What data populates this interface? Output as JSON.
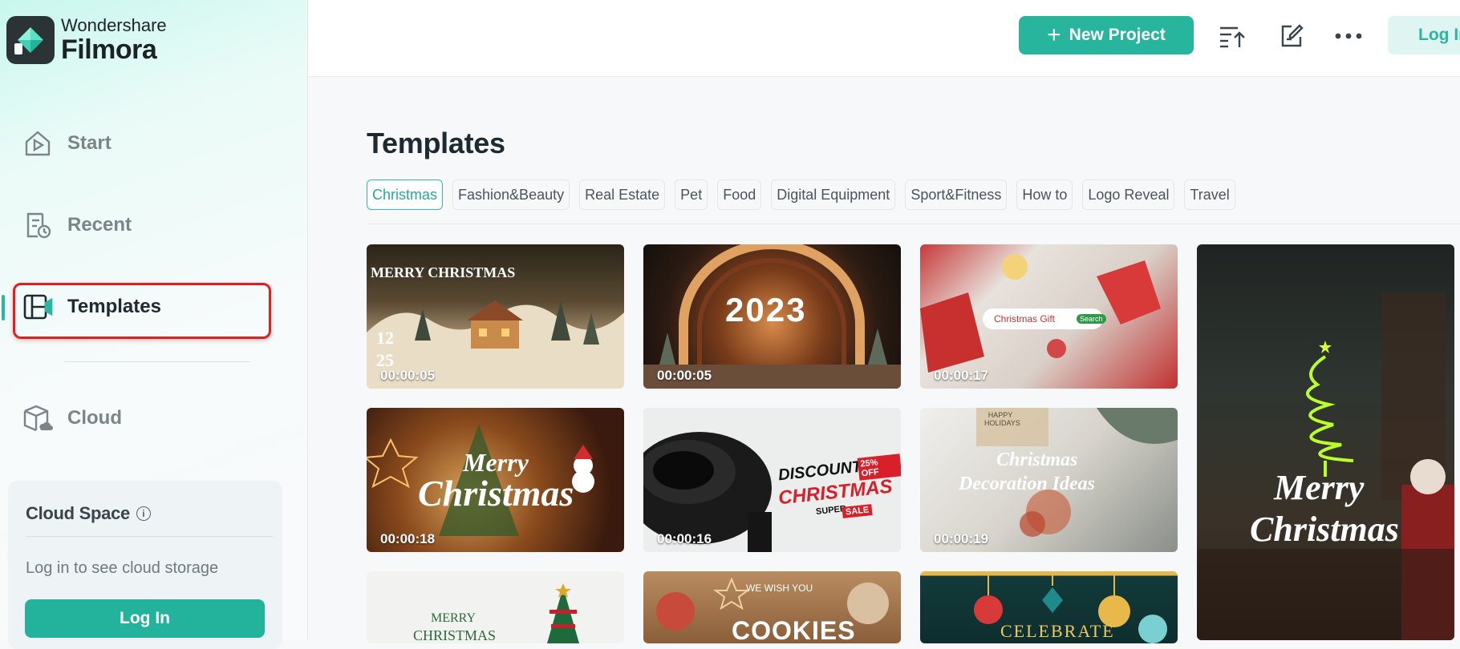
{
  "app": {
    "brand": "Wondershare",
    "product": "Filmora"
  },
  "sidebar": {
    "items": [
      {
        "label": "Start",
        "icon": "home-play-icon"
      },
      {
        "label": "Recent",
        "icon": "recent-file-icon"
      },
      {
        "label": "Templates",
        "icon": "templates-icon",
        "active": true
      },
      {
        "label": "Cloud",
        "icon": "cloud-box-icon"
      }
    ],
    "cloud_space": {
      "title": "Cloud Space",
      "info_icon": "ⓘ",
      "message": "Log in to see cloud storage",
      "login_label": "Log In"
    }
  },
  "topbar": {
    "new_project_label": "New Project",
    "plus": "+",
    "login_label": "Log In"
  },
  "main": {
    "title": "Templates",
    "tabs": [
      "Christmas",
      "Fashion&Beauty",
      "Real Estate",
      "Pet",
      "Food",
      "Digital Equipment",
      "Sport&Fitness",
      "How to",
      "Logo Reveal",
      "Travel"
    ],
    "cards": [
      {
        "duration": "00:00:05",
        "text1": "MERRY CHRISTMAS",
        "text2": "12",
        "text3": "25"
      },
      {
        "duration": "00:00:05",
        "text1": "2023"
      },
      {
        "duration": "00:00:17",
        "text1": "Christmas Gift",
        "text2": "Search"
      },
      {
        "text1": "Merry",
        "text2": "Christmas"
      },
      {
        "duration": "00:00:18",
        "text1": "Merry",
        "text2": "Christmas"
      },
      {
        "duration": "00:00:16",
        "text1": "DISCOUNT",
        "text2": "CHRISTMAS",
        "text3": "25% OFF",
        "text4": "SUPER",
        "text5": "SALE"
      },
      {
        "duration": "00:00:19",
        "text1": "Christmas",
        "text2": "Decoration Ideas",
        "text3": "HAPPY HOLIDAYS"
      },
      {
        "text1": "MERRY",
        "text2": "CHRISTMAS"
      },
      {
        "text1": "WE WISH YOU",
        "text2": "COOKIES"
      },
      {
        "text1": "CELEBRATE"
      }
    ]
  },
  "colors": {
    "accent": "#27b59e",
    "highlight": "#e02020"
  }
}
